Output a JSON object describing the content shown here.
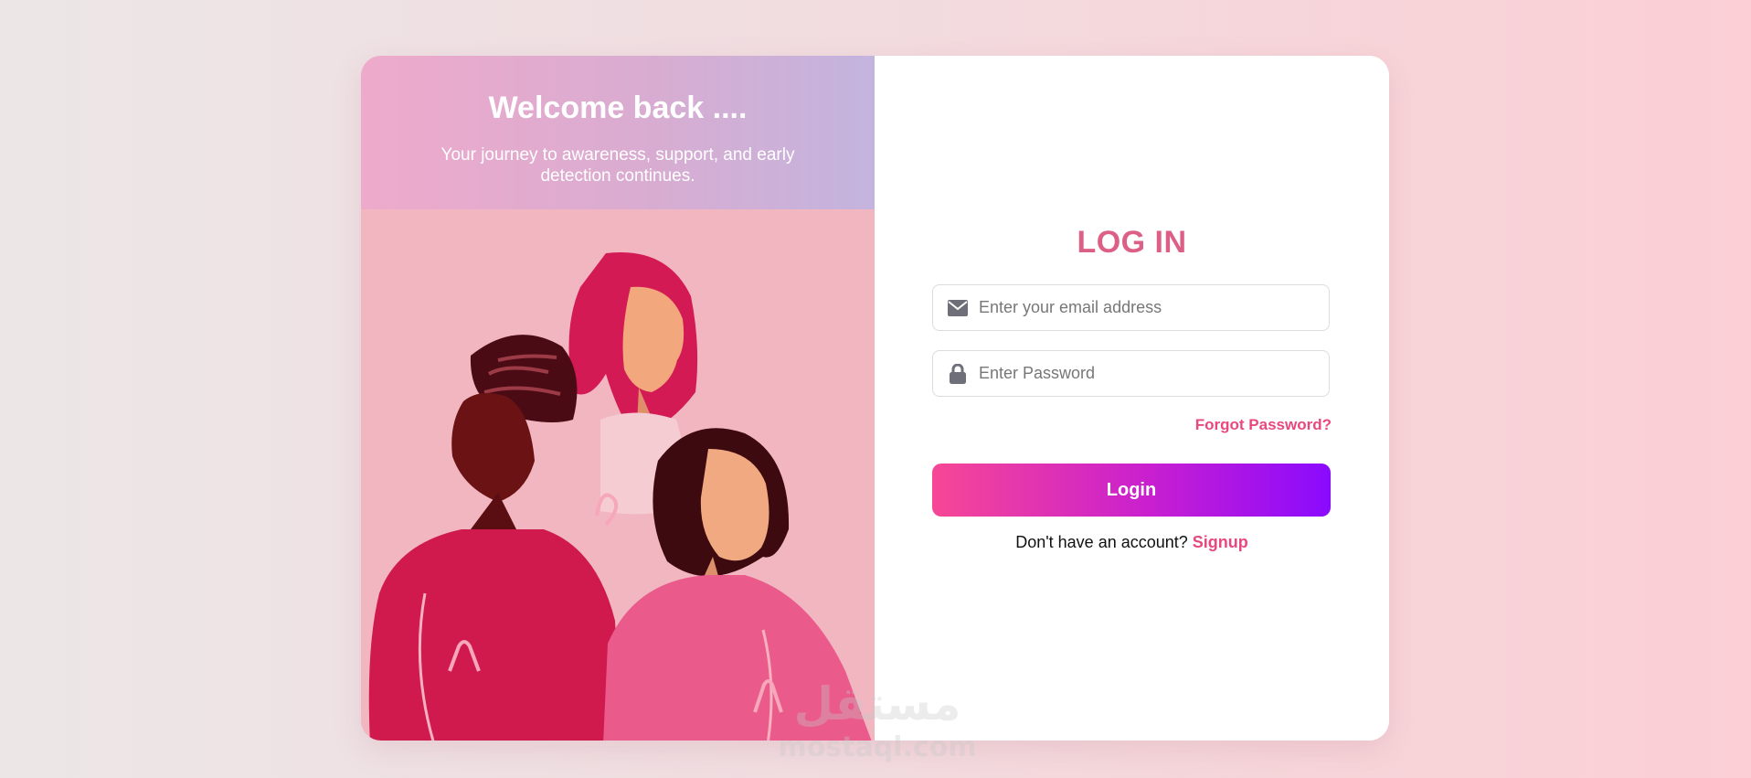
{
  "hero": {
    "title": "Welcome back ....",
    "subtitle": "Your journey to awareness, support, and early detection continues."
  },
  "form": {
    "title": "LOG IN",
    "email_placeholder": "Enter your email address",
    "password_placeholder": "Enter Password",
    "forgot_label": "Forgot Password?",
    "login_label": "Login",
    "signup_prompt": "Don't have an account?",
    "signup_label": "Signup"
  },
  "icons": {
    "email": "envelope-icon",
    "password": "lock-icon"
  },
  "watermark": {
    "arabic": "مستقل",
    "latin": "mostaql.com"
  },
  "colors": {
    "accent": "#e8487f",
    "title": "#dc5f86",
    "button_start": "#f74795",
    "button_end": "#8a0afe"
  }
}
